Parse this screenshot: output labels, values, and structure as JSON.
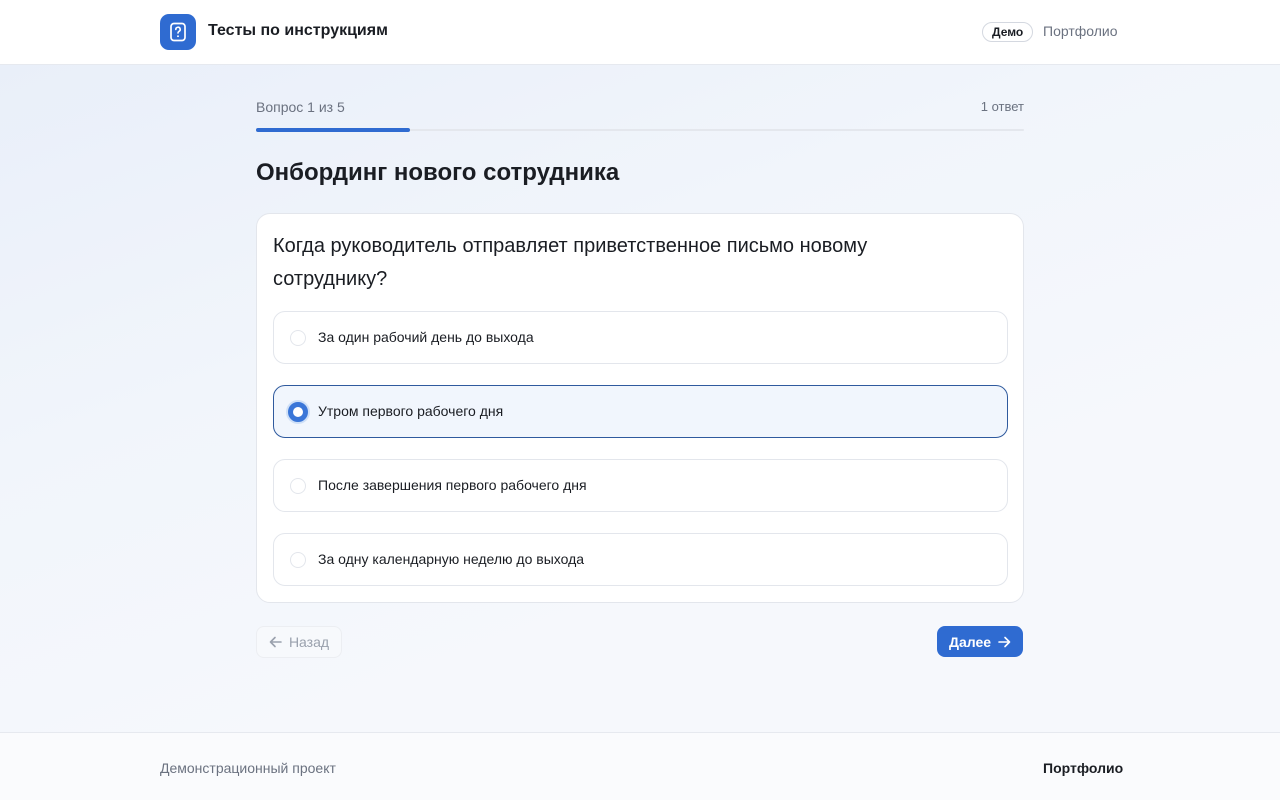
{
  "header": {
    "app_title": "Тесты по инструкциям",
    "logo_icon": "question-document-icon",
    "badge": "Демо",
    "portfolio_link": "Портфолио"
  },
  "progress": {
    "label": "Вопрос 1 из 5",
    "current": 1,
    "total": 5,
    "fraction": 0.2,
    "answers_label": "1 ответ"
  },
  "quiz": {
    "title": "Онбординг нового сотрудника",
    "question": "Когда руководитель отправляет приветственное письмо новому сотруднику?",
    "options": [
      {
        "label": "За один рабочий день до выхода",
        "selected": false
      },
      {
        "label": "Утром первого рабочего дня",
        "selected": true
      },
      {
        "label": "После завершения первого рабочего дня",
        "selected": false
      },
      {
        "label": "За одну календарную неделю до выхода",
        "selected": false
      }
    ]
  },
  "nav": {
    "back_label": "Назад",
    "back_icon": "arrow-left-icon",
    "next_label": "Далее",
    "next_icon": "arrow-right-icon"
  },
  "footer": {
    "text": "Демонстрационный проект",
    "portfolio_link": "Портфолио"
  },
  "colors": {
    "accent": "#2f6bd1",
    "text": "#1a1d23",
    "muted": "#6b7280",
    "border": "#e3e6ec"
  }
}
